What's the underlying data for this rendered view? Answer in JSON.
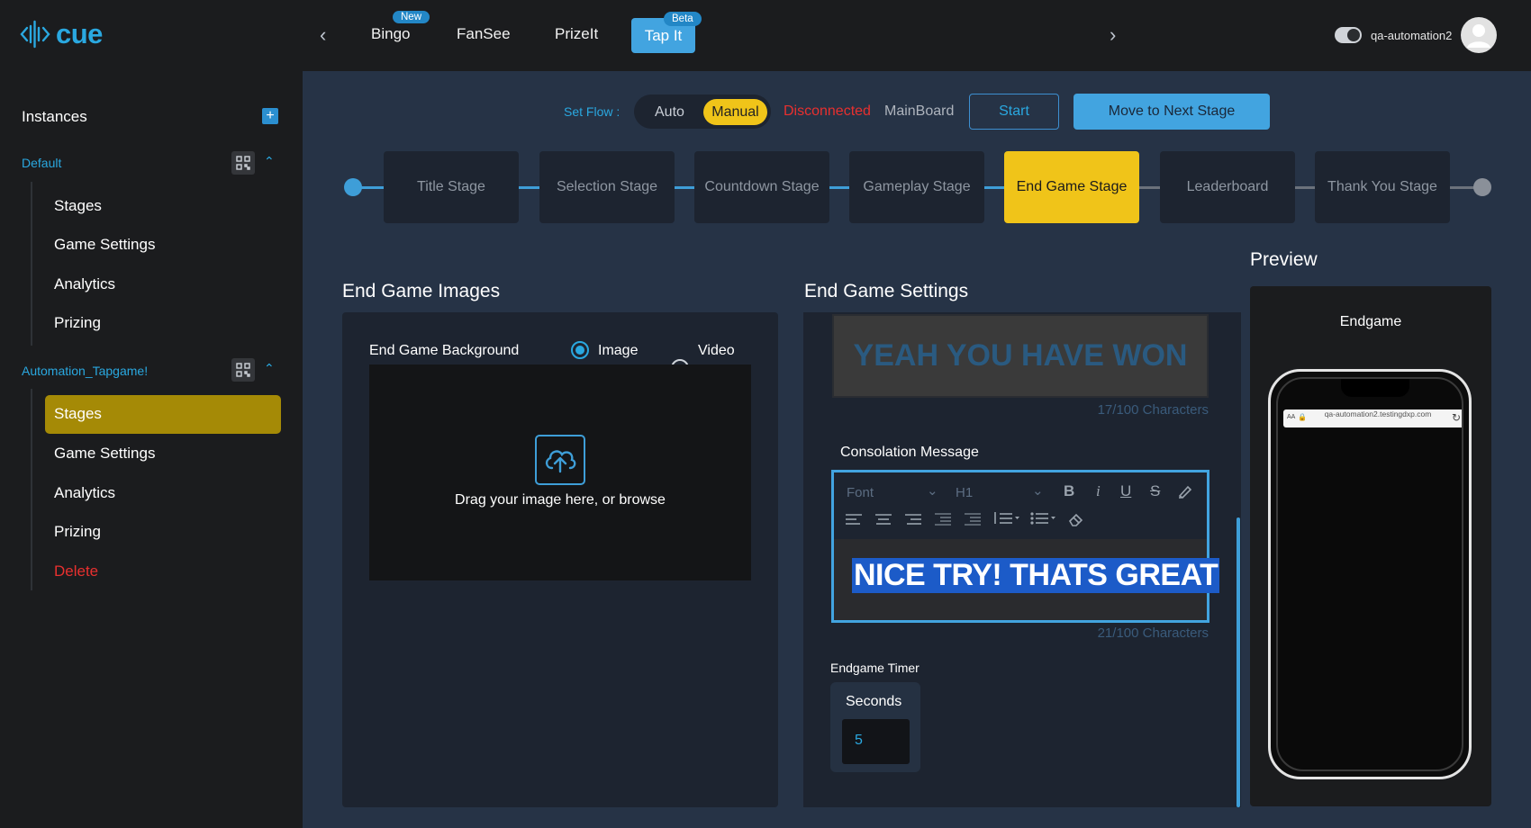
{
  "app": {
    "logo_text": "cue"
  },
  "nav": {
    "tabs": [
      {
        "label": "Bingo",
        "badge": "New"
      },
      {
        "label": "FanSee"
      },
      {
        "label": "PrizeIt"
      },
      {
        "label": "Tap It",
        "badge": "Beta",
        "active": true
      }
    ],
    "user": "qa-automation2"
  },
  "sidebar": {
    "title": "Instances",
    "instances": [
      {
        "name": "Default",
        "items": [
          "Stages",
          "Game Settings",
          "Analytics",
          "Prizing"
        ]
      },
      {
        "name": "Automation_Tapgame!",
        "items": [
          "Stages",
          "Game Settings",
          "Analytics",
          "Prizing",
          "Delete"
        ],
        "active_item": "Stages"
      }
    ]
  },
  "flow": {
    "label": "Set Flow :",
    "options": [
      "Auto",
      "Manual"
    ],
    "selected": "Manual",
    "connection_status": "Disconnected",
    "board": "MainBoard",
    "start_label": "Start",
    "next_label": "Move to Next Stage"
  },
  "stages": [
    "Title Stage",
    "Selection Stage",
    "Countdown Stage",
    "Gameplay Stage",
    "End Game Stage",
    "Leaderboard",
    "Thank You Stage"
  ],
  "active_stage": "End Game Stage",
  "images": {
    "heading": "End Game Images",
    "background_label": "End Game Background",
    "option_image": "Image",
    "option_video": "Video",
    "selected": "Image",
    "drop_text": "Drag your image here, or browse"
  },
  "settings": {
    "heading": "End Game Settings",
    "win_message": "YEAH YOU HAVE WON",
    "win_count": "17/100 Characters",
    "consolation_label": "Consolation Message",
    "font_placeholder": "Font",
    "heading_level": "H1",
    "consolation_message": "NICE TRY! THATS GREAT",
    "consolation_count": "21/100 Characters",
    "timer_label": "Endgame Timer",
    "seconds_label": "Seconds",
    "seconds_value": "5"
  },
  "preview": {
    "title": "Preview",
    "screen_label": "Endgame",
    "url": "qa-automation2.testingdxp.com",
    "url_prefix": "AA"
  },
  "colors": {
    "accent": "#2aa8e0",
    "active_stage": "#f0c419",
    "danger": "#e8302f",
    "sidebar_active": "#a58a06"
  }
}
